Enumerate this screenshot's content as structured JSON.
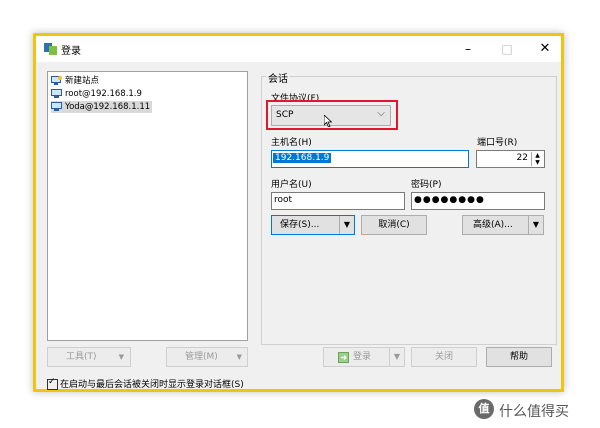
{
  "window": {
    "title": "登录",
    "minimize": "–",
    "maximize": "□",
    "close": "✕"
  },
  "tree": {
    "items": [
      {
        "label": "新建站点",
        "icon": "new-site-icon"
      },
      {
        "label": "root@192.168.1.9",
        "icon": "monitor-icon"
      },
      {
        "label": "Yoda@192.168.1.11",
        "icon": "monitor-icon",
        "selected": true
      }
    ]
  },
  "session": {
    "group_label": "会话",
    "protocol_label": "文件协议(F)",
    "protocol_value": "SCP",
    "host_label": "主机名(H)",
    "host_value": "192.168.1.9",
    "port_label": "端口号(R)",
    "port_value": "22",
    "user_label": "用户名(U)",
    "user_value": "root",
    "password_label": "密码(P)",
    "password_value": "●●●●●●●●",
    "save_label": "保存(S)...",
    "cancel_label": "取消(C)",
    "advanced_label": "高级(A)..."
  },
  "bottom": {
    "tools_label": "工具(T)",
    "manage_label": "管理(M)",
    "login_label": "登录",
    "close_label": "关闭",
    "help_label": "帮助",
    "checkbox_label": "在启动与最后会话被关闭时显示登录对话框(S)"
  },
  "watermark": {
    "icon": "值",
    "text": "什么值得买"
  },
  "colors": {
    "highlight": "#e0182d",
    "focus": "#0078d7",
    "frame": "#f1c40f"
  }
}
